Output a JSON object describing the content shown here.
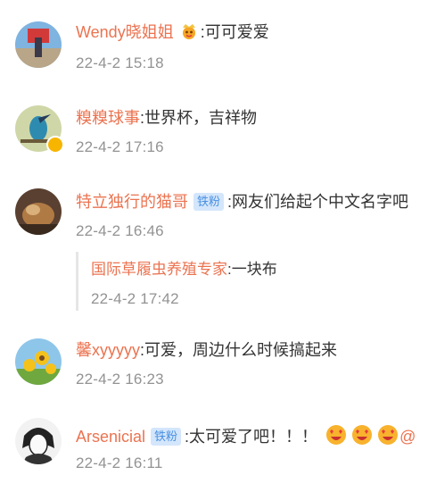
{
  "comments": [
    {
      "user": "Wendy晓姐姐",
      "text": ":可可爱爱",
      "time": "22-4-2 15:18"
    },
    {
      "user": "糗糗球事",
      "text": ":世界杯，吉祥物",
      "time": "22-4-2 17:16"
    },
    {
      "user": "特立独行的猫哥",
      "badge": "铁粉",
      "text": ":网友们给起个中文名字吧",
      "time": "22-4-2 16:46",
      "reply": {
        "user": "国际草履虫养殖专家",
        "text": ":一块布",
        "time": "22-4-2 17:42"
      }
    },
    {
      "user": "馨xyyyyy",
      "text": ":可爱，周边什么时候搞起来",
      "time": "22-4-2 16:23"
    },
    {
      "user": "Arsenicial",
      "badge": "铁粉",
      "text": ":太可爱了吧！！！",
      "time": "22-4-2 16:11",
      "trailing": "@"
    }
  ]
}
